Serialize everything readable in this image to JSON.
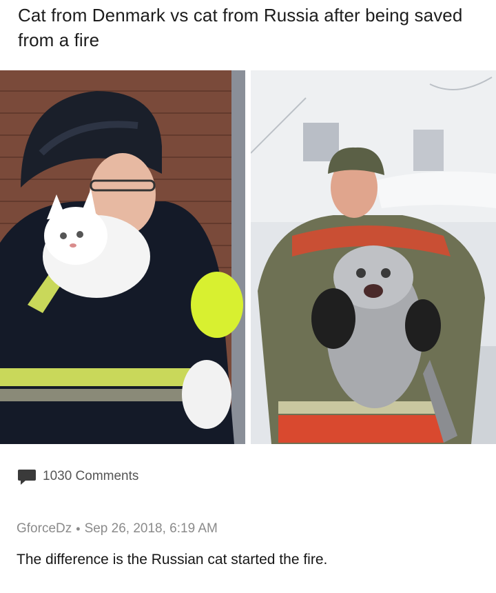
{
  "post": {
    "title": "Cat from Denmark vs cat from Russia after being saved from a fire"
  },
  "photos": {
    "left": {
      "name": "denmark-firefighter-white-cat"
    },
    "right": {
      "name": "russia-firefighter-frozen-cat"
    }
  },
  "footer": {
    "comments_label": "1030 Comments",
    "comment_icon": "speech-bubble-icon"
  },
  "reply": {
    "username": "GforceDz",
    "separator": "•",
    "timestamp": "Sep 26, 2018, 6:19 AM",
    "text": "The difference is the Russian cat started the fire."
  },
  "colors": {
    "text": "#1c1c1c",
    "muted": "#8a8a8a",
    "icon": "#3a3a3a"
  }
}
